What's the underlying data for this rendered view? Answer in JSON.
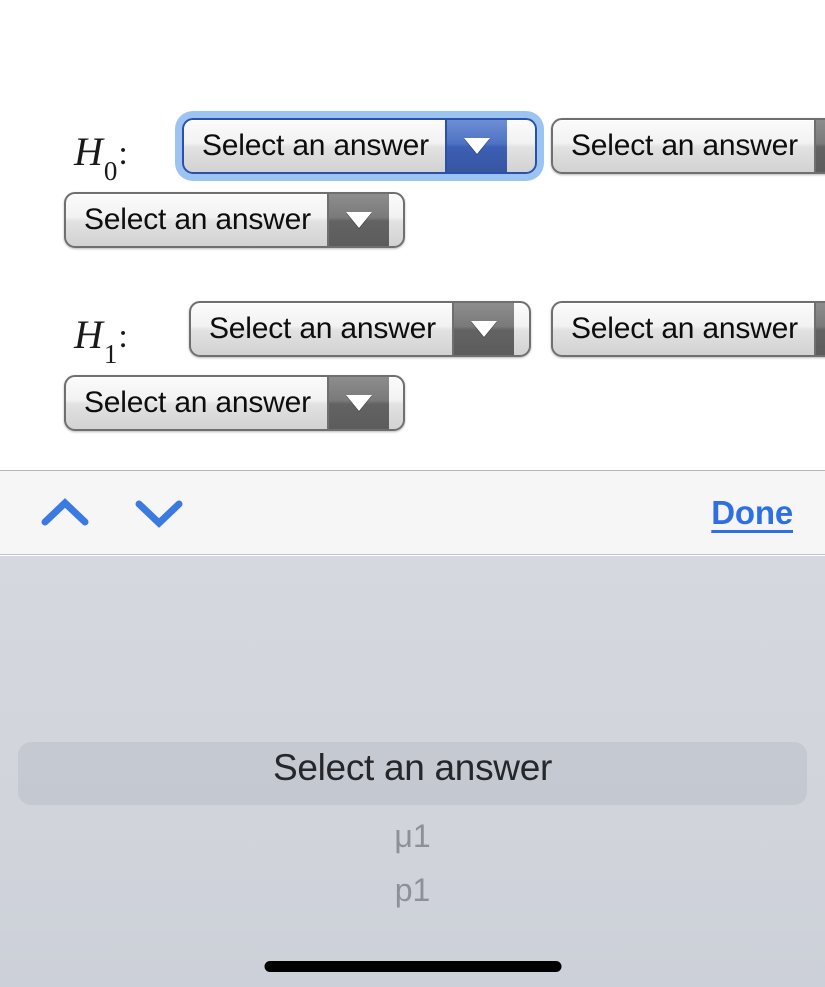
{
  "page": {
    "background_color": "#ffffff"
  },
  "form": {
    "rows": [
      {
        "label_letter": "H",
        "label_sub": "0",
        "label_colon": ":",
        "selects": [
          {
            "value": "Select an answer",
            "focused": true,
            "arrow_icon": "chevron-down-icon",
            "clipped": false
          },
          {
            "value": "Select an answer",
            "focused": false,
            "arrow_icon": "chevron-down-icon",
            "clipped": true
          },
          {
            "value": "Select an answer",
            "focused": false,
            "arrow_icon": "chevron-down-icon",
            "clipped": false
          }
        ]
      },
      {
        "label_letter": "H",
        "label_sub": "1",
        "label_colon": ":",
        "selects": [
          {
            "value": "Select an answer",
            "focused": false,
            "arrow_icon": "chevron-down-icon",
            "clipped": false
          },
          {
            "value": "Select an answer",
            "focused": false,
            "arrow_icon": "chevron-down-icon",
            "clipped": true
          },
          {
            "value": "Select an answer",
            "focused": false,
            "arrow_icon": "chevron-down-icon",
            "clipped": false
          }
        ]
      }
    ]
  },
  "keyboard_toolbar": {
    "previous_field_icon": "chevron-up-icon",
    "next_field_icon": "chevron-down-icon",
    "done_label": "Done",
    "done_color": "#2f6fe4",
    "background_color": "#f6f6f7"
  },
  "picker": {
    "background_color": "#d3d6dd",
    "selected_value": "Select an answer",
    "options": [
      "Select an answer",
      "μ1",
      "p1"
    ],
    "selected_index": 0
  },
  "home_indicator": {
    "color": "#000000"
  }
}
